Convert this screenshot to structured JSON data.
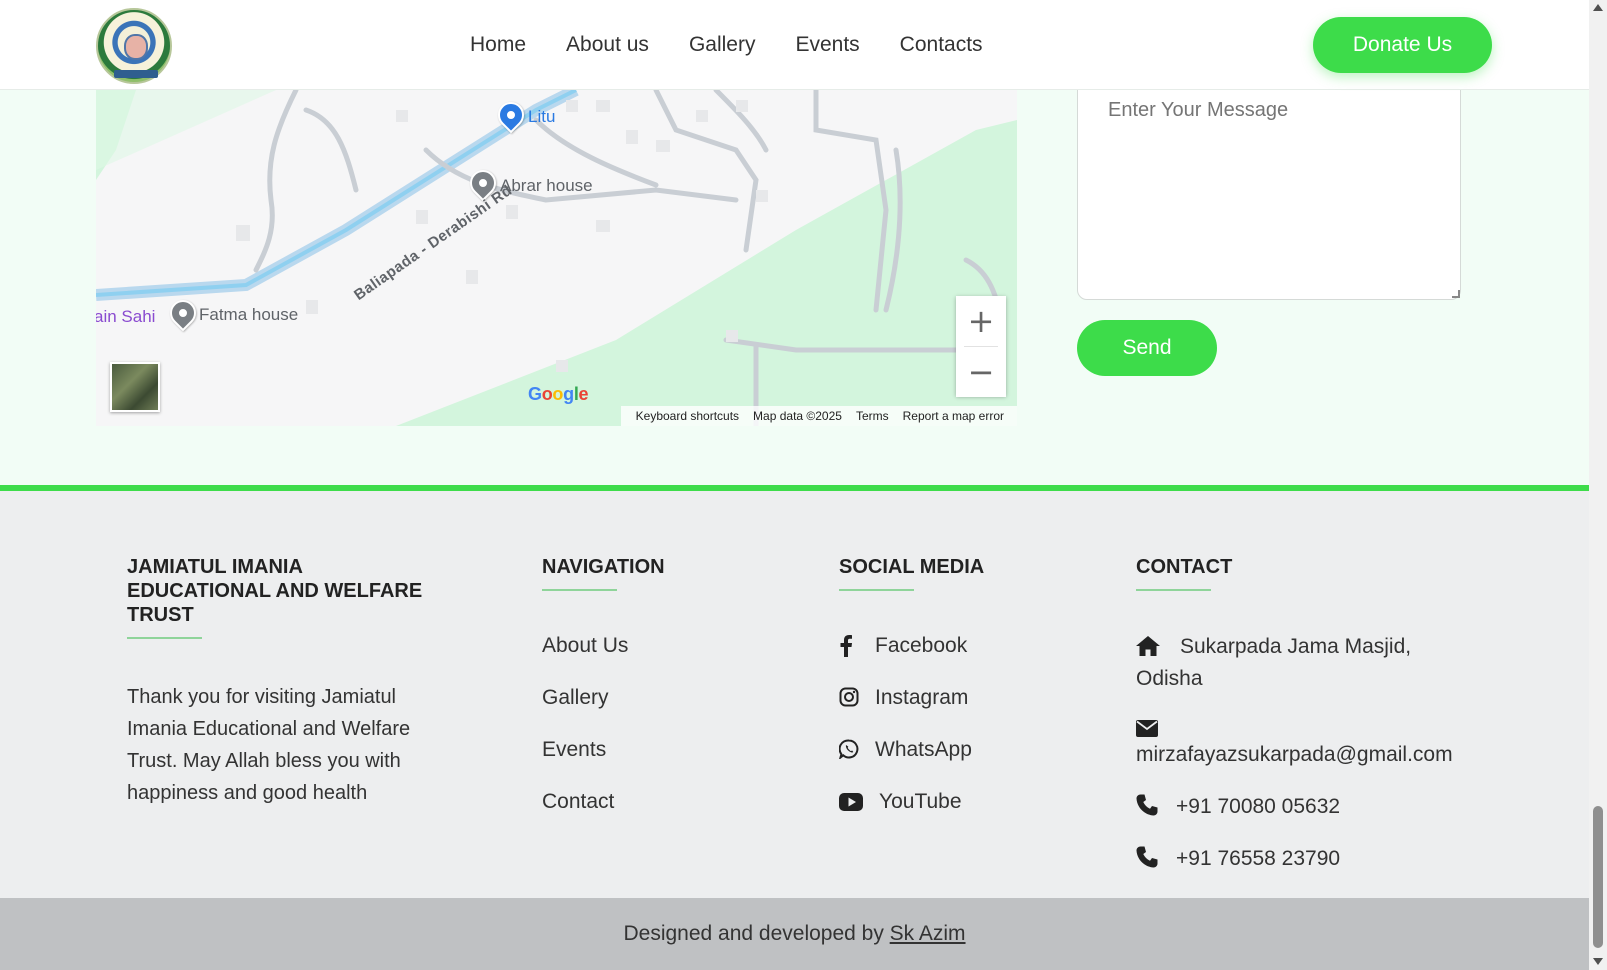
{
  "header": {
    "nav": [
      "Home",
      "About us",
      "Gallery",
      "Events",
      "Contacts"
    ],
    "donate_label": "Donate Us"
  },
  "map": {
    "places": {
      "litu": "Litu",
      "abrar": "Abrar house",
      "fatma": "Fatma house",
      "sahi": "ain Sahi"
    },
    "road": "Baliapada - Derabishi Rd",
    "zoom_in": "+",
    "zoom_out": "−",
    "google": "Google",
    "attribution": [
      "Keyboard shortcuts",
      "Map data ©2025",
      "Terms",
      "Report a map error"
    ]
  },
  "form": {
    "message_placeholder": "Enter Your Message",
    "send_label": "Send"
  },
  "footer": {
    "about": {
      "title": "JAMIATUL IMANIA EDUCATIONAL AND WELFARE TRUST",
      "text": "Thank you for visiting Jamiatul Imania Educational and Welfare Trust. May Allah bless you with happiness and good health"
    },
    "navigation": {
      "title": "NAVIGATION",
      "links": [
        "About Us",
        "Gallery",
        "Events",
        "Contact"
      ]
    },
    "social": {
      "title": "SOCIAL MEDIA",
      "links": [
        {
          "label": "Facebook",
          "icon": "facebook-icon"
        },
        {
          "label": "Instagram",
          "icon": "instagram-icon"
        },
        {
          "label": "WhatsApp",
          "icon": "whatsapp-icon"
        },
        {
          "label": "YouTube",
          "icon": "youtube-icon"
        }
      ]
    },
    "contact": {
      "title": "CONTACT",
      "address": "Sukarpada Jama Masjid, Odisha",
      "email": "mirzafayazsukarpada@gmail.com",
      "phone1": "+91 70080 05632",
      "phone2": "+91 76558 23790"
    }
  },
  "bottom": {
    "text": "Designed and developed by ",
    "author": "Sk Azim"
  },
  "colors": {
    "accent": "#3ddc4a",
    "footer_bg": "#edeeef",
    "bottom_bg": "#bfc1c3"
  }
}
